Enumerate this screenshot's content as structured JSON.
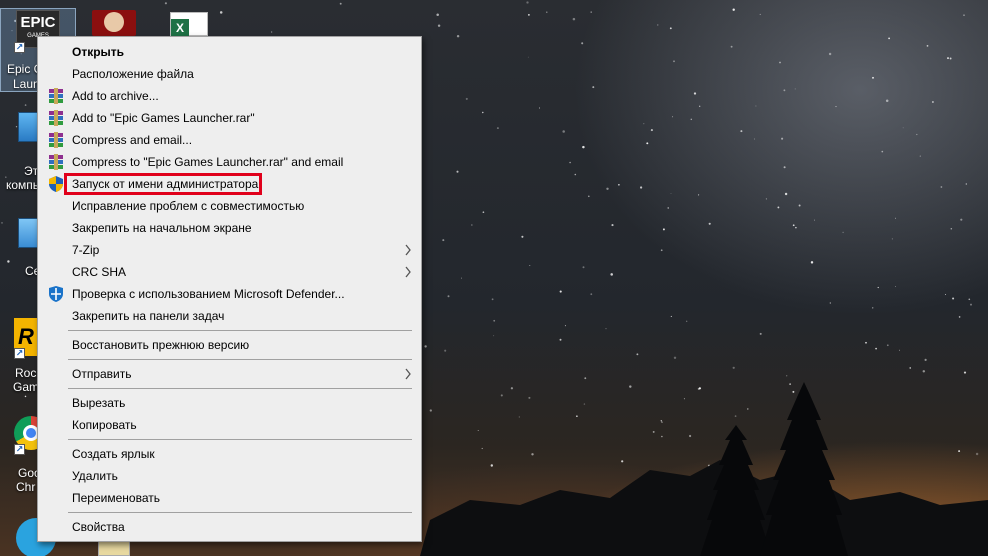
{
  "desktop": {
    "icons": [
      {
        "name": "epic-games-launcher",
        "label_lines": [
          "Epic G",
          "Launc"
        ],
        "logo_text": "EPIC",
        "logo_sub": "GAMES"
      },
      {
        "name": "this-computer",
        "label_lines": [
          "Эт",
          "компь"
        ]
      },
      {
        "name": "network",
        "label_lines": [
          "Се"
        ]
      },
      {
        "name": "rockstar-games",
        "label_lines": [
          "Roc",
          "Gam"
        ]
      },
      {
        "name": "google-chrome",
        "label_lines": [
          "Goo",
          "Chr"
        ]
      }
    ]
  },
  "context_menu": {
    "items": [
      {
        "id": "open",
        "label": "Открыть",
        "bold": true,
        "icon": ""
      },
      {
        "id": "file-location",
        "label": "Расположение файла",
        "icon": ""
      },
      {
        "id": "add-to-archive",
        "label": "Add to archive...",
        "icon": "winrar-icon"
      },
      {
        "id": "add-to-rar",
        "label": "Add to \"Epic Games Launcher.rar\"",
        "icon": "winrar-icon"
      },
      {
        "id": "compress-email",
        "label": "Compress and email...",
        "icon": "winrar-icon"
      },
      {
        "id": "compress-rar-email",
        "label": "Compress to \"Epic Games Launcher.rar\" and email",
        "icon": "winrar-icon"
      },
      {
        "id": "run-as-admin",
        "label": "Запуск от имени администратора",
        "icon": "uac-shield-icon",
        "highlighted": true
      },
      {
        "id": "troubleshoot-compat",
        "label": "Исправление проблем с совместимостью",
        "icon": ""
      },
      {
        "id": "pin-start",
        "label": "Закрепить на начальном экране",
        "icon": ""
      },
      {
        "id": "7zip",
        "label": "7-Zip",
        "icon": "",
        "submenu": true
      },
      {
        "id": "crc-sha",
        "label": "CRC SHA",
        "icon": "",
        "submenu": true
      },
      {
        "id": "defender-scan",
        "label": "Проверка с использованием Microsoft Defender...",
        "icon": "defender-icon"
      },
      {
        "id": "pin-taskbar",
        "label": "Закрепить на панели задач",
        "icon": ""
      },
      {
        "id": "restore-previous",
        "label": "Восстановить прежнюю версию",
        "icon": ""
      },
      {
        "id": "send-to",
        "label": "Отправить",
        "icon": "",
        "submenu": true
      },
      {
        "id": "cut",
        "label": "Вырезать",
        "icon": ""
      },
      {
        "id": "copy",
        "label": "Копировать",
        "icon": ""
      },
      {
        "id": "create-shortcut",
        "label": "Создать ярлык",
        "icon": ""
      },
      {
        "id": "delete",
        "label": "Удалить",
        "icon": ""
      },
      {
        "id": "rename",
        "label": "Переименовать",
        "icon": ""
      },
      {
        "id": "properties",
        "label": "Свойства",
        "icon": ""
      }
    ]
  },
  "colors": {
    "menu_bg": "#eeeeee",
    "highlight_border": "#e0001b",
    "separator": "#a0a0a0"
  }
}
